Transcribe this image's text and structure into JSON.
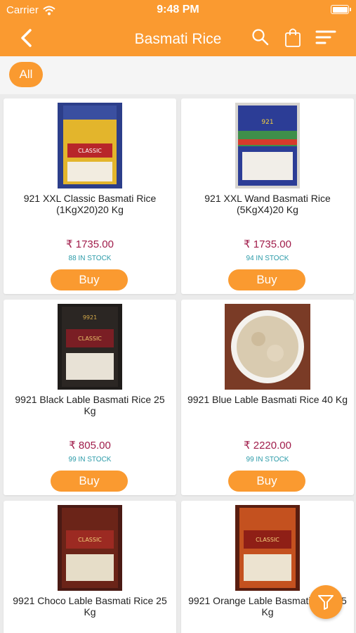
{
  "status_bar": {
    "carrier": "Carrier",
    "time": "9:48 PM"
  },
  "header": {
    "title": "Basmati Rice"
  },
  "filter_chips": [
    {
      "label": "All"
    }
  ],
  "products": [
    {
      "name": "921 XXL Classic  Basmati Rice (1KgX20)20 Kg",
      "price": "₹ 1735.00",
      "stock_count": "88",
      "stock_label": "IN STOCK",
      "buy_label": "Buy",
      "image": "rice-bag-classic-xxl"
    },
    {
      "name": "921 XXL Wand  Basmati Rice (5KgX4)20 Kg",
      "price": "₹ 1735.00",
      "stock_count": "94",
      "stock_label": "IN STOCK",
      "buy_label": "Buy",
      "image": "rice-bag-wand"
    },
    {
      "name": "9921 Black Lable  Basmati Rice 25 Kg",
      "price": "₹ 805.00",
      "stock_count": "99",
      "stock_label": "IN STOCK",
      "buy_label": "Buy",
      "image": "rice-bag-black-label"
    },
    {
      "name": "9921 Blue Lable  Basmati Rice 40 Kg",
      "price": "₹ 2220.00",
      "stock_count": "99",
      "stock_label": "IN STOCK",
      "buy_label": "Buy",
      "image": "rice-bowl"
    },
    {
      "name": "9921 Choco Lable  Basmati Rice 25 Kg",
      "price": "",
      "stock_count": "",
      "stock_label": "",
      "buy_label": "",
      "image": "rice-bag-choco-label"
    },
    {
      "name": "9921 Orange Lable  Basmati Rice 25 Kg",
      "price": "",
      "stock_count": "",
      "stock_label": "",
      "buy_label": "",
      "image": "rice-bag-orange-label"
    }
  ],
  "icons": {
    "back": "back-arrow-icon",
    "search": "search-icon",
    "bag": "shopping-bag-icon",
    "sort": "sort-icon",
    "filter": "filter-icon"
  },
  "colors": {
    "accent": "#fa9a30",
    "price": "#a01c4a",
    "stock": "#2a9aa8",
    "background": "#ebebeb"
  }
}
